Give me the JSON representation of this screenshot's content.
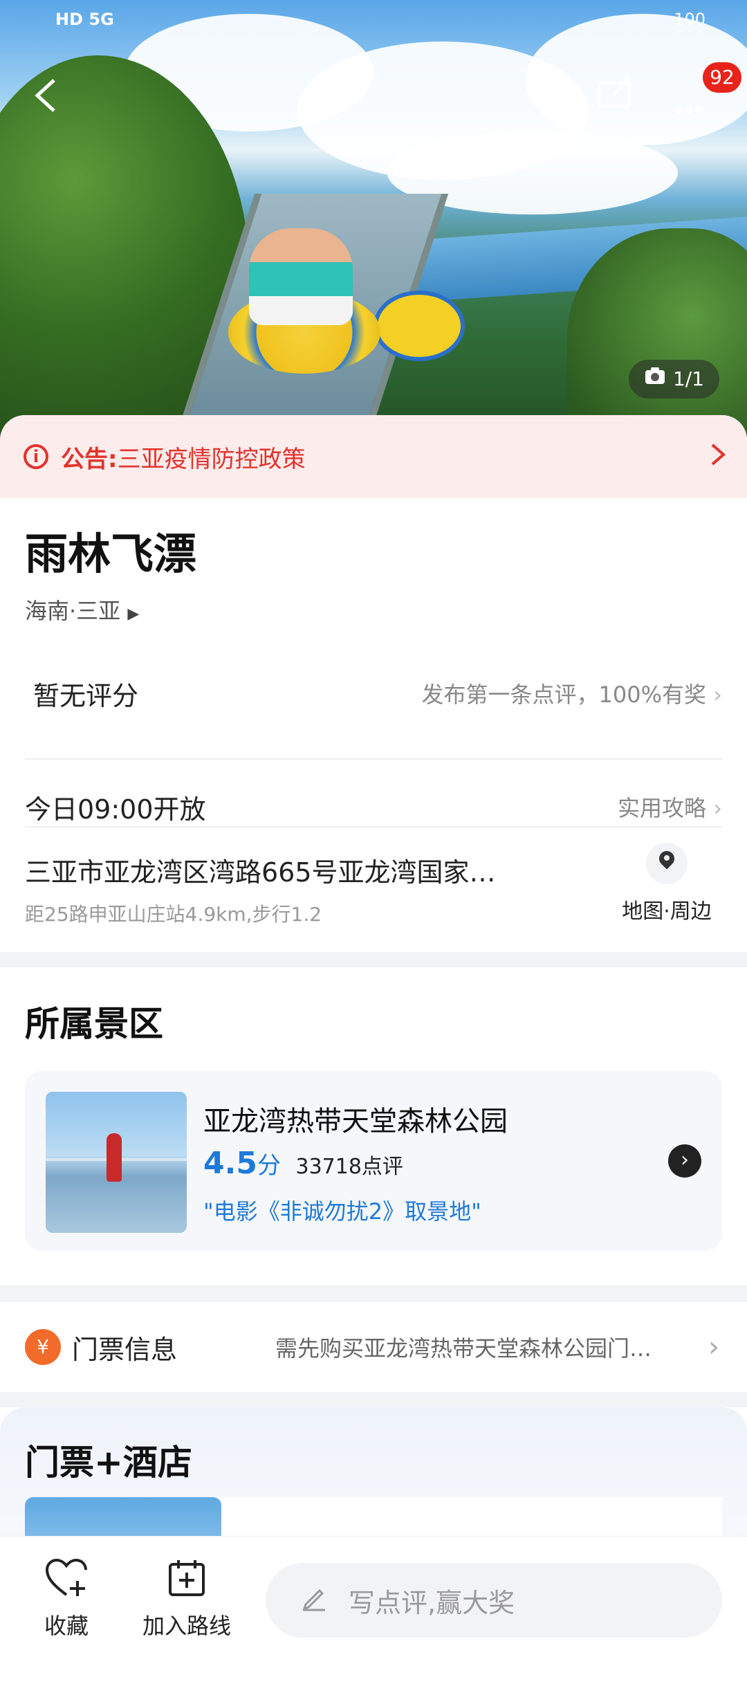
{
  "status": {
    "left": "HD 5G",
    "right": "100"
  },
  "hero": {
    "badge": "92",
    "counter": "1/1"
  },
  "notice": {
    "label": "公告:",
    "text": "三亚疫情防控政策"
  },
  "attraction": {
    "title": "雨林飞漂",
    "region": "海南·三亚"
  },
  "rating_row": {
    "left": "暂无评分",
    "right": "发布第一条点评，100%有奖"
  },
  "hours_row": {
    "left": "今日09:00开放",
    "right": "实用攻略"
  },
  "address": {
    "line1": "三亚市亚龙湾区湾路665号亚龙湾国家…",
    "line2": "距25路申亚山庄站4.9km,步行1.2",
    "map_label": "地图·周边"
  },
  "scenic_section": {
    "title": "所属景区",
    "name": "亚龙湾热带天堂森林公园",
    "score": "4.5",
    "score_unit": "分",
    "reviews": "33718点评",
    "quote": "\"电影《非诚勿扰2》取景地\""
  },
  "ticket": {
    "label": "门票信息",
    "desc": "需先购买亚龙湾热带天堂森林公园门…"
  },
  "package_section": {
    "title": "门票+酒店"
  },
  "bottom_bar": {
    "favorite": "收藏",
    "add_route": "加入路线",
    "review_placeholder": "写点评,赢大奖"
  },
  "colors": {
    "accent_red": "#e2322b",
    "link_blue": "#1e7ad8",
    "ticket_orange": "#f26b2a"
  }
}
